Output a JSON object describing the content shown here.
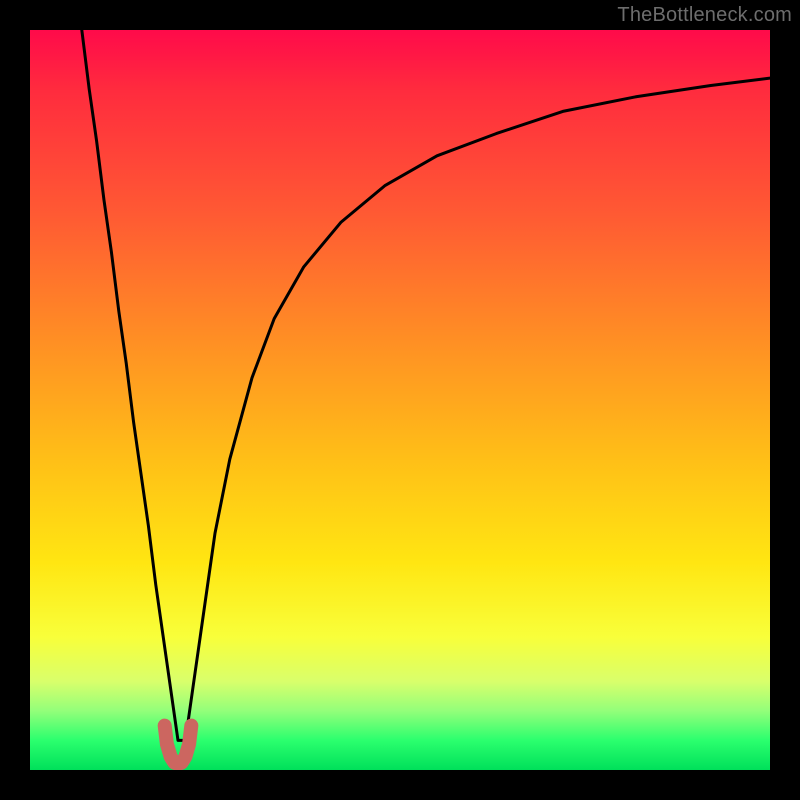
{
  "watermark": {
    "text": "TheBottleneck.com"
  },
  "chart_data": {
    "type": "line",
    "title": "",
    "xlabel": "",
    "ylabel": "",
    "xlim": [
      0,
      100
    ],
    "ylim": [
      0,
      100
    ],
    "grid": false,
    "legend": false,
    "notes": "Background is a red→green vertical gradient (red at top, green at bottom). A single black curve descends sharply from top-left to a narrow minimum near x≈20, y≈0, then rises with decreasing slope toward the top-right. A short salmon-colored U-shaped marker sits at the trough.",
    "series": [
      {
        "name": "bottleneck-curve",
        "color": "#000000",
        "x": [
          7,
          8,
          9,
          10,
          11,
          12,
          13,
          14,
          15,
          16,
          17,
          18,
          19,
          20,
          21,
          22,
          23,
          24,
          25,
          27,
          30,
          33,
          37,
          42,
          48,
          55,
          63,
          72,
          82,
          92,
          100
        ],
        "y": [
          100,
          92,
          85,
          77,
          70,
          62,
          55,
          47,
          40,
          33,
          25,
          18,
          11,
          4,
          4,
          11,
          18,
          25,
          32,
          42,
          53,
          61,
          68,
          74,
          79,
          83,
          86,
          89,
          91,
          92.5,
          93.5
        ]
      },
      {
        "name": "trough-marker",
        "color": "#cc6660",
        "x": [
          18.2,
          18.5,
          19.0,
          19.5,
          20.0,
          20.5,
          21.0,
          21.5,
          21.8
        ],
        "y": [
          6.0,
          3.5,
          1.8,
          1.0,
          0.8,
          1.0,
          1.8,
          3.5,
          6.0
        ]
      }
    ]
  }
}
